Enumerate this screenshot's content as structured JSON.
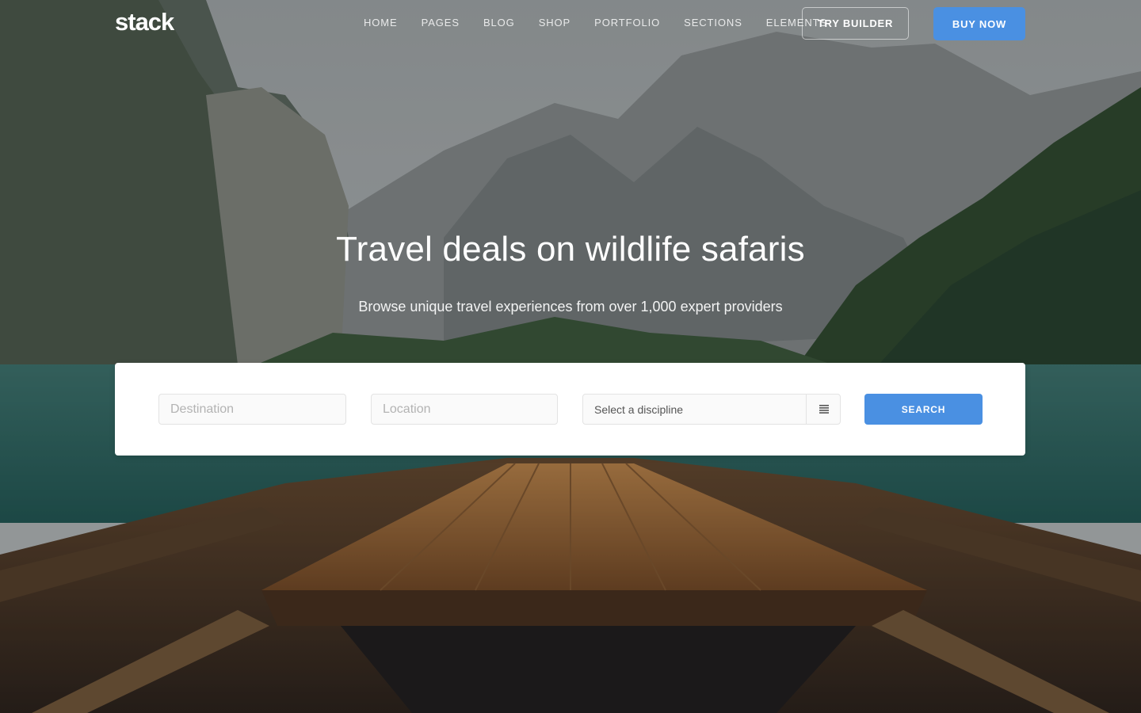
{
  "brand": {
    "logo_text": "stack"
  },
  "nav": {
    "items": [
      {
        "label": "HOME"
      },
      {
        "label": "PAGES"
      },
      {
        "label": "BLOG"
      },
      {
        "label": "SHOP"
      },
      {
        "label": "PORTFOLIO"
      },
      {
        "label": "SECTIONS"
      },
      {
        "label": "ELEMENTS"
      }
    ],
    "try_builder_label": "TRY BUILDER",
    "buy_now_label": "BUY NOW"
  },
  "hero": {
    "title": "Travel deals on wildlife safaris",
    "subtitle": "Browse unique travel experiences from over 1,000 expert providers",
    "background_image": "mountain-lake-boat-photo"
  },
  "search": {
    "destination_placeholder": "Destination",
    "location_placeholder": "Location",
    "discipline_selected": "Select a discipline",
    "discipline_icon": "menu-lines-icon",
    "button_label": "SEARCH"
  },
  "colors": {
    "accent": "#4a90e2",
    "card": "#ffffff",
    "field_border": "#e3e3e3"
  }
}
